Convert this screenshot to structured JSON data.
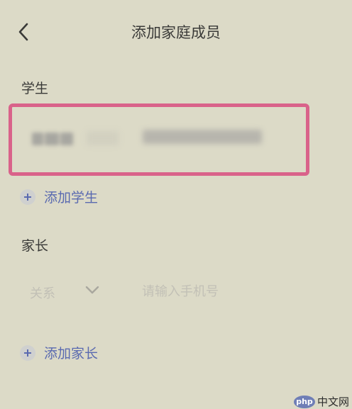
{
  "header": {
    "title": "添加家庭成员",
    "back_icon": "chevron-left-icon"
  },
  "student_section": {
    "title": "学生",
    "entries": [
      {
        "name": "",
        "id": "",
        "note": "name and id are blurred (redacted) in the screenshot"
      }
    ],
    "add_label": "添加学生"
  },
  "parent_section": {
    "title": "家长",
    "relation": {
      "label": "关系",
      "icon": "chevron-down-icon"
    },
    "phone": {
      "placeholder": "请输入手机号",
      "value": ""
    },
    "add_label": "添加家长"
  },
  "watermark": {
    "logo_text": "php",
    "text": "中文网"
  },
  "colors": {
    "background": "#dcdac7",
    "highlight_border": "#d9628a",
    "link": "#5a6ab0",
    "placeholder": "#c2c0b6"
  }
}
